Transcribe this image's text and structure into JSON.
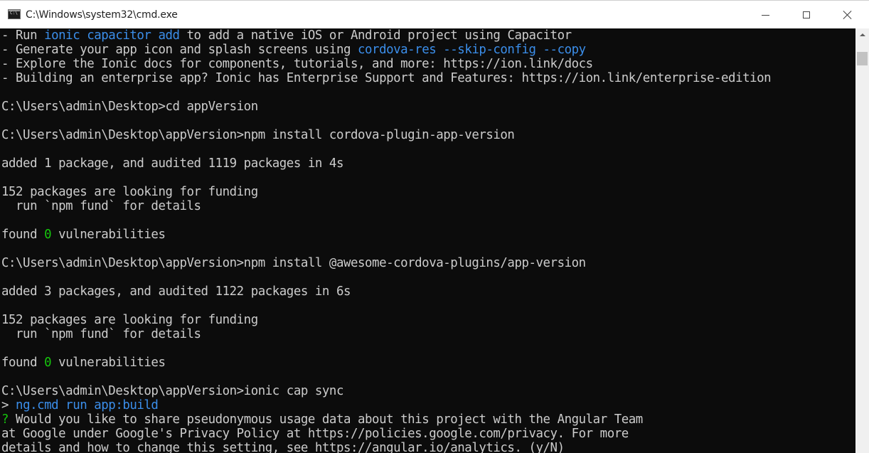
{
  "window": {
    "title": "C:\\Windows\\system32\\cmd.exe",
    "icon": "cmd-icon",
    "controls": {
      "minimize": "minimize-icon",
      "maximize": "maximize-icon",
      "close": "close-icon"
    }
  },
  "colors": {
    "background": "#0c0c0c",
    "text": "#cccccc",
    "highlight_blue": "#3b8eea",
    "highlight_green": "#16c60c"
  },
  "console": {
    "lines": [
      [
        {
          "t": "- Run ",
          "c": "default"
        },
        {
          "t": "ionic capacitor add",
          "c": "blue"
        },
        {
          "t": " to add a native iOS or Android project using Capacitor",
          "c": "default"
        }
      ],
      [
        {
          "t": "- Generate your app icon and splash screens using ",
          "c": "default"
        },
        {
          "t": "cordova-res --skip-config --copy",
          "c": "blue"
        }
      ],
      [
        {
          "t": "- Explore the Ionic docs for components, tutorials, and more: https://ion.link/docs",
          "c": "default"
        }
      ],
      [
        {
          "t": "- Building an enterprise app? Ionic has Enterprise Support and Features: https://ion.link/enterprise-edition",
          "c": "default"
        }
      ],
      [
        {
          "t": "",
          "c": "default"
        }
      ],
      [
        {
          "t": "C:\\Users\\admin\\Desktop>cd appVersion",
          "c": "default"
        }
      ],
      [
        {
          "t": "",
          "c": "default"
        }
      ],
      [
        {
          "t": "C:\\Users\\admin\\Desktop\\appVersion>npm install cordova-plugin-app-version",
          "c": "default"
        }
      ],
      [
        {
          "t": "",
          "c": "default"
        }
      ],
      [
        {
          "t": "added 1 package, and audited 1119 packages in 4s",
          "c": "default"
        }
      ],
      [
        {
          "t": "",
          "c": "default"
        }
      ],
      [
        {
          "t": "152 packages are looking for funding",
          "c": "default"
        }
      ],
      [
        {
          "t": "  run `npm fund` for details",
          "c": "default"
        }
      ],
      [
        {
          "t": "",
          "c": "default"
        }
      ],
      [
        {
          "t": "found ",
          "c": "default"
        },
        {
          "t": "0",
          "c": "green"
        },
        {
          "t": " vulnerabilities",
          "c": "default"
        }
      ],
      [
        {
          "t": "",
          "c": "default"
        }
      ],
      [
        {
          "t": "C:\\Users\\admin\\Desktop\\appVersion>npm install @awesome-cordova-plugins/app-version",
          "c": "default"
        }
      ],
      [
        {
          "t": "",
          "c": "default"
        }
      ],
      [
        {
          "t": "added 3 packages, and audited 1122 packages in 6s",
          "c": "default"
        }
      ],
      [
        {
          "t": "",
          "c": "default"
        }
      ],
      [
        {
          "t": "152 packages are looking for funding",
          "c": "default"
        }
      ],
      [
        {
          "t": "  run `npm fund` for details",
          "c": "default"
        }
      ],
      [
        {
          "t": "",
          "c": "default"
        }
      ],
      [
        {
          "t": "found ",
          "c": "default"
        },
        {
          "t": "0",
          "c": "green"
        },
        {
          "t": " vulnerabilities",
          "c": "default"
        }
      ],
      [
        {
          "t": "",
          "c": "default"
        }
      ],
      [
        {
          "t": "C:\\Users\\admin\\Desktop\\appVersion>ionic cap sync",
          "c": "default"
        }
      ],
      [
        {
          "t": "> ",
          "c": "default"
        },
        {
          "t": "ng.cmd run app:build",
          "c": "blue"
        }
      ],
      [
        {
          "t": "?",
          "c": "green"
        },
        {
          "t": " Would you like to share pseudonymous usage data about this project with the Angular Team",
          "c": "default"
        }
      ],
      [
        {
          "t": "at Google under Google's Privacy Policy at https://policies.google.com/privacy. For more",
          "c": "default"
        }
      ],
      [
        {
          "t": "details and how to change this setting, see https://angular.io/analytics. (y/N)",
          "c": "default"
        }
      ]
    ]
  }
}
